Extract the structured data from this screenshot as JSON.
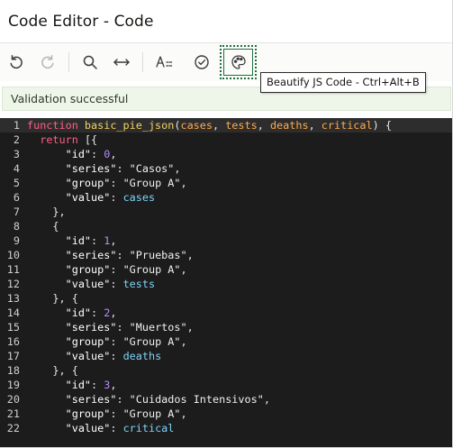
{
  "window": {
    "title": "Code Editor - Code"
  },
  "toolbar": {
    "buttons": [
      {
        "name": "undo",
        "icon": "undo-icon",
        "enabled": true
      },
      {
        "name": "redo",
        "icon": "redo-icon",
        "enabled": false
      },
      {
        "name": "find",
        "icon": "search-icon",
        "enabled": true
      },
      {
        "name": "replace",
        "icon": "horizontal-arrows-icon",
        "enabled": true
      },
      {
        "name": "autocomplete",
        "icon": "autocomplete-icon",
        "enabled": true
      },
      {
        "name": "validate",
        "icon": "check-circle-icon",
        "enabled": true
      },
      {
        "name": "beautify",
        "icon": "palette-icon",
        "enabled": true
      }
    ],
    "tooltip": "Beautify JS Code - Ctrl+Alt+B"
  },
  "status": {
    "message": "Validation successful",
    "color": "#eef6e9"
  },
  "editor": {
    "current_line": 1,
    "lines": [
      [
        [
          "kw",
          "function "
        ],
        [
          "fn",
          "basic_pie_json"
        ],
        [
          "punc",
          "("
        ],
        [
          "param",
          "cases"
        ],
        [
          "punc",
          ", "
        ],
        [
          "param",
          "tests"
        ],
        [
          "punc",
          ", "
        ],
        [
          "param",
          "deaths"
        ],
        [
          "punc",
          ", "
        ],
        [
          "param",
          "critical"
        ],
        [
          "punc",
          ") {"
        ]
      ],
      [
        [
          "punc",
          "  "
        ],
        [
          "kw",
          "return"
        ],
        [
          "punc",
          " [{"
        ]
      ],
      [
        [
          "punc",
          "      "
        ],
        [
          "key",
          "\"id\""
        ],
        [
          "punc",
          ": "
        ],
        [
          "num",
          "0"
        ],
        [
          "punc",
          ","
        ]
      ],
      [
        [
          "punc",
          "      "
        ],
        [
          "key",
          "\"series\""
        ],
        [
          "punc",
          ": "
        ],
        [
          "str",
          "\"Casos\""
        ],
        [
          "punc",
          ","
        ]
      ],
      [
        [
          "punc",
          "      "
        ],
        [
          "key",
          "\"group\""
        ],
        [
          "punc",
          ": "
        ],
        [
          "str",
          "\"Group A\""
        ],
        [
          "punc",
          ","
        ]
      ],
      [
        [
          "punc",
          "      "
        ],
        [
          "key",
          "\"value\""
        ],
        [
          "punc",
          ": "
        ],
        [
          "var",
          "cases"
        ]
      ],
      [
        [
          "punc",
          "    },"
        ]
      ],
      [
        [
          "punc",
          "    {"
        ]
      ],
      [
        [
          "punc",
          "      "
        ],
        [
          "key",
          "\"id\""
        ],
        [
          "punc",
          ": "
        ],
        [
          "num",
          "1"
        ],
        [
          "punc",
          ","
        ]
      ],
      [
        [
          "punc",
          "      "
        ],
        [
          "key",
          "\"series\""
        ],
        [
          "punc",
          ": "
        ],
        [
          "str",
          "\"Pruebas\""
        ],
        [
          "punc",
          ","
        ]
      ],
      [
        [
          "punc",
          "      "
        ],
        [
          "key",
          "\"group\""
        ],
        [
          "punc",
          ": "
        ],
        [
          "str",
          "\"Group A\""
        ],
        [
          "punc",
          ","
        ]
      ],
      [
        [
          "punc",
          "      "
        ],
        [
          "key",
          "\"value\""
        ],
        [
          "punc",
          ": "
        ],
        [
          "var",
          "tests"
        ]
      ],
      [
        [
          "punc",
          "    }, {"
        ]
      ],
      [
        [
          "punc",
          "      "
        ],
        [
          "key",
          "\"id\""
        ],
        [
          "punc",
          ": "
        ],
        [
          "num",
          "2"
        ],
        [
          "punc",
          ","
        ]
      ],
      [
        [
          "punc",
          "      "
        ],
        [
          "key",
          "\"series\""
        ],
        [
          "punc",
          ": "
        ],
        [
          "str",
          "\"Muertos\""
        ],
        [
          "punc",
          ","
        ]
      ],
      [
        [
          "punc",
          "      "
        ],
        [
          "key",
          "\"group\""
        ],
        [
          "punc",
          ": "
        ],
        [
          "str",
          "\"Group A\""
        ],
        [
          "punc",
          ","
        ]
      ],
      [
        [
          "punc",
          "      "
        ],
        [
          "key",
          "\"value\""
        ],
        [
          "punc",
          ": "
        ],
        [
          "var",
          "deaths"
        ]
      ],
      [
        [
          "punc",
          "    }, {"
        ]
      ],
      [
        [
          "punc",
          "      "
        ],
        [
          "key",
          "\"id\""
        ],
        [
          "punc",
          ": "
        ],
        [
          "num",
          "3"
        ],
        [
          "punc",
          ","
        ]
      ],
      [
        [
          "punc",
          "      "
        ],
        [
          "key",
          "\"series\""
        ],
        [
          "punc",
          ": "
        ],
        [
          "str",
          "\"Cuidados Intensivos\""
        ],
        [
          "punc",
          ","
        ]
      ],
      [
        [
          "punc",
          "      "
        ],
        [
          "key",
          "\"group\""
        ],
        [
          "punc",
          ": "
        ],
        [
          "str",
          "\"Group A\""
        ],
        [
          "punc",
          ","
        ]
      ],
      [
        [
          "punc",
          "      "
        ],
        [
          "key",
          "\"value\""
        ],
        [
          "punc",
          ": "
        ],
        [
          "var",
          "critical"
        ]
      ]
    ]
  }
}
